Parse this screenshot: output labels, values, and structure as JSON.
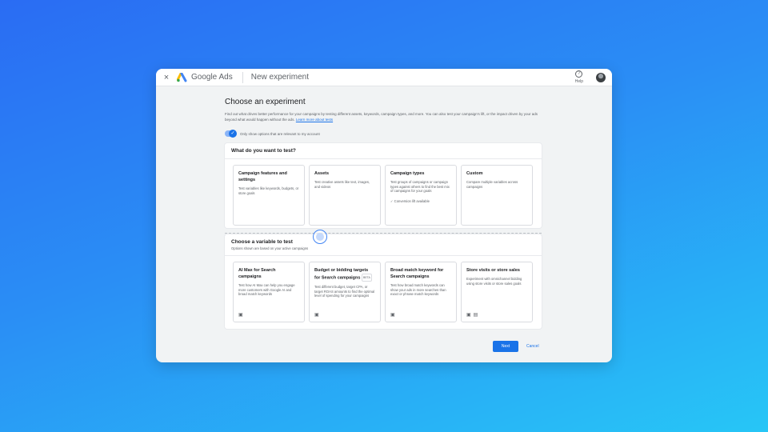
{
  "topbar": {
    "close_label": "×",
    "brand_name": "Google",
    "brand_product": "Ads",
    "page_name": "New experiment",
    "help_label": "Help"
  },
  "main": {
    "title": "Choose an experiment",
    "description": "Find out what drives better performance for your campaigns by testing different assets, keywords, campaign types, and more. You can also test your campaign's lift, or the impact driven by your ads beyond what would happen without the ads.",
    "learn_more": "Learn more about tests",
    "toggle_label": "Only show options that are relevant to my account"
  },
  "section1": {
    "title": "What do you want to test?",
    "cards": [
      {
        "title": "Campaign features and settings",
        "desc": "Test variables like keywords, budgets, or store goals",
        "note": ""
      },
      {
        "title": "Assets",
        "desc": "Test creative assets like text, images, and videos",
        "note": ""
      },
      {
        "title": "Campaign types",
        "desc": "Test groups of campaigns or campaign types against others to find the best mix of campaigns for your goals",
        "note": "✓ Conversion lift available"
      },
      {
        "title": "Custom",
        "desc": "Compare multiple variables across campaigns",
        "note": ""
      }
    ]
  },
  "section2": {
    "title": "Choose a variable to test",
    "subtitle": "Options shown are based on your active campaigns",
    "cards": [
      {
        "title": "AI Max for Search campaigns",
        "badge": "",
        "desc": "Test how AI Max can help you engage more customers with Google AI and broad match keywords"
      },
      {
        "title": "Budget or bidding targets for Search campaigns",
        "badge": "BETA",
        "desc": "Test different budget, target CPA, or target ROAS amounts to find the optimal level of spending for your campaigns"
      },
      {
        "title": "Broad match keyword for Search campaigns",
        "badge": "",
        "desc": "Test how broad match keywords can show your ads in more searches than exact or phrase match keywords"
      },
      {
        "title": "Store visits or store sales",
        "badge": "",
        "desc": "Experiment with omnichannel bidding using store visits or store sales goals"
      }
    ]
  },
  "footer": {
    "next_label": "Next",
    "cancel_label": "Cancel"
  },
  "icons": [
    "close-icon",
    "google-ads-logo-icon",
    "help-icon",
    "avatar",
    "check-icon",
    "search-campaign-icon",
    "store-icon"
  ],
  "colors": {
    "accent": "#1a73e8",
    "background_start": "#2a6cf3",
    "background_end": "#27c6f6"
  }
}
